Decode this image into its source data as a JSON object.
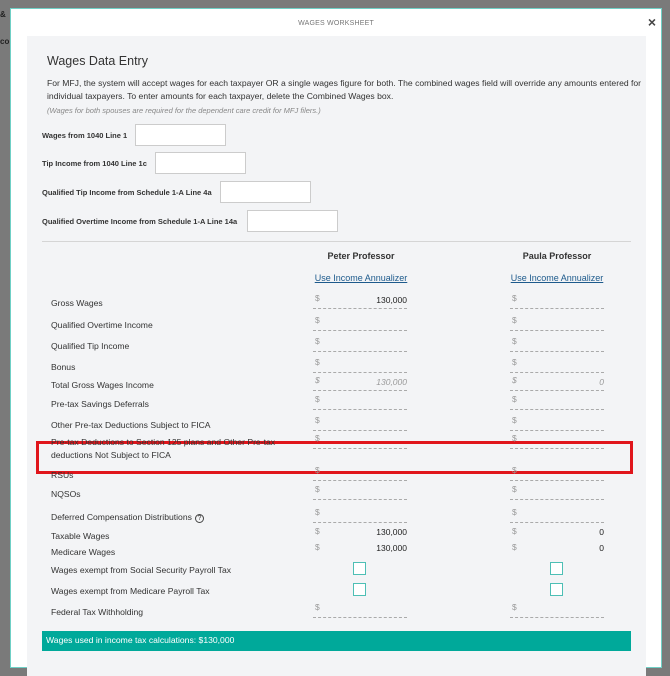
{
  "background": {
    "text1": "&",
    "text2": "co"
  },
  "dialog": {
    "title": "WAGES WORKSHEET",
    "close_icon": "×"
  },
  "section": {
    "heading": "Wages Data Entry",
    "intro": "For MFJ, the system will accept wages for each taxpayer OR a single wages figure for both. The combined wages field will override any amounts entered for individual taxpayers. To enter amounts for each taxpayer, delete the Combined Wages box.",
    "note": "(Wages for both spouses are required for the dependent care credit for MFJ filers.)"
  },
  "top_fields": [
    {
      "label": "Wages from 1040 Line 1",
      "value": ""
    },
    {
      "label": "Tip Income from 1040 Line 1c",
      "value": ""
    },
    {
      "label": "Qualified Tip Income from Schedule 1-A Line 4a",
      "value": ""
    },
    {
      "label": "Qualified Overtime Income from Schedule 1-A Line 14a",
      "value": ""
    }
  ],
  "columns": [
    {
      "name": "Peter Professor",
      "annualizer": "Use Income Annualizer"
    },
    {
      "name": "Paula Professor",
      "annualizer": "Use Income Annualizer"
    }
  ],
  "currency": "$",
  "rows": [
    {
      "label": "Gross Wages",
      "type": "input",
      "values": [
        "130,000",
        ""
      ]
    },
    {
      "label": "Qualified Overtime Income",
      "type": "input",
      "values": [
        "",
        ""
      ]
    },
    {
      "label": "Qualified Tip Income",
      "type": "input",
      "values": [
        "",
        ""
      ]
    },
    {
      "label": "Bonus",
      "type": "input",
      "values": [
        "",
        ""
      ]
    },
    {
      "label": "Total Gross Wages Income",
      "type": "calc",
      "values": [
        "130,000",
        "0"
      ]
    },
    {
      "label": "Pre-tax Savings Deferrals",
      "type": "input",
      "values": [
        "",
        ""
      ]
    },
    {
      "label": "Other Pre-tax Deductions Subject to FICA",
      "type": "input",
      "values": [
        "",
        ""
      ]
    },
    {
      "label": "Pre-tax Deductions to Section 125 plans and Other Pre-tax deductions Not Subject to FICA",
      "type": "input",
      "values": [
        "",
        ""
      ],
      "highlighted": true
    },
    {
      "label": "RSUs",
      "type": "input",
      "values": [
        "",
        ""
      ]
    },
    {
      "label": "NQSOs",
      "type": "input",
      "values": [
        "",
        ""
      ]
    },
    {
      "label": "Deferred Compensation Distributions",
      "type": "input",
      "values": [
        "",
        ""
      ],
      "help": "?"
    },
    {
      "label": "Taxable Wages",
      "type": "readonly",
      "values": [
        "130,000",
        "0"
      ]
    },
    {
      "label": "Medicare Wages",
      "type": "readonly",
      "values": [
        "130,000",
        "0"
      ]
    },
    {
      "label": "Wages exempt from Social Security Payroll Tax",
      "type": "checkbox",
      "values": [
        false,
        false
      ]
    },
    {
      "label": "Wages exempt from Medicare Payroll Tax",
      "type": "checkbox",
      "values": [
        false,
        false
      ]
    },
    {
      "label": "Federal Tax Withholding",
      "type": "input",
      "values": [
        "",
        ""
      ]
    }
  ],
  "footer": "Wages used in income tax calculations: $130,000",
  "colors": {
    "accent": "#00a99a",
    "highlight": "#e0151b",
    "link": "#1d5a8c"
  }
}
